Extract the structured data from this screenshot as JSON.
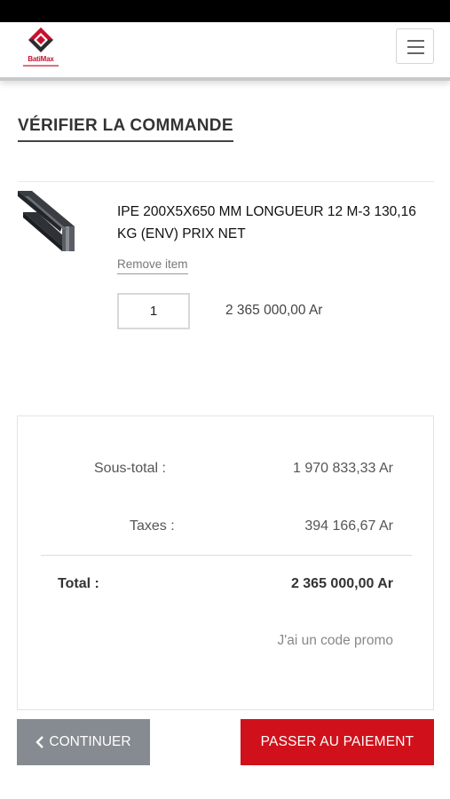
{
  "app": {
    "brand_name": "BatiMax"
  },
  "header": {
    "menu_icon": "hamburger-icon"
  },
  "page": {
    "title": "VÉRIFIER LA COMMANDE"
  },
  "cart": {
    "items": [
      {
        "name": "IPE 200X5X650 MM LONGUEUR 12 M-3 130,16 KG (ENV) PRIX NET",
        "remove_label": "Remove item",
        "quantity": "1",
        "price": "2 365 000,00 Ar",
        "image_icon": "steel-i-beam-image"
      }
    ]
  },
  "summary": {
    "subtotal_label": "Sous-total :",
    "subtotal_value": "1 970 833,33 Ar",
    "taxes_label": "Taxes :",
    "taxes_value": "394 166,67 Ar",
    "total_label": "Total :",
    "total_value": "2 365 000,00 Ar",
    "promo_label": "J'ai un code promo"
  },
  "actions": {
    "continue_icon": "chevron-left-icon",
    "continue_label": "CONTINUER",
    "pay_label": "PASSER AU PAIEMENT"
  },
  "colors": {
    "accent": "#d0111b",
    "secondary_button": "#858b91",
    "status_bar": "#000000"
  }
}
